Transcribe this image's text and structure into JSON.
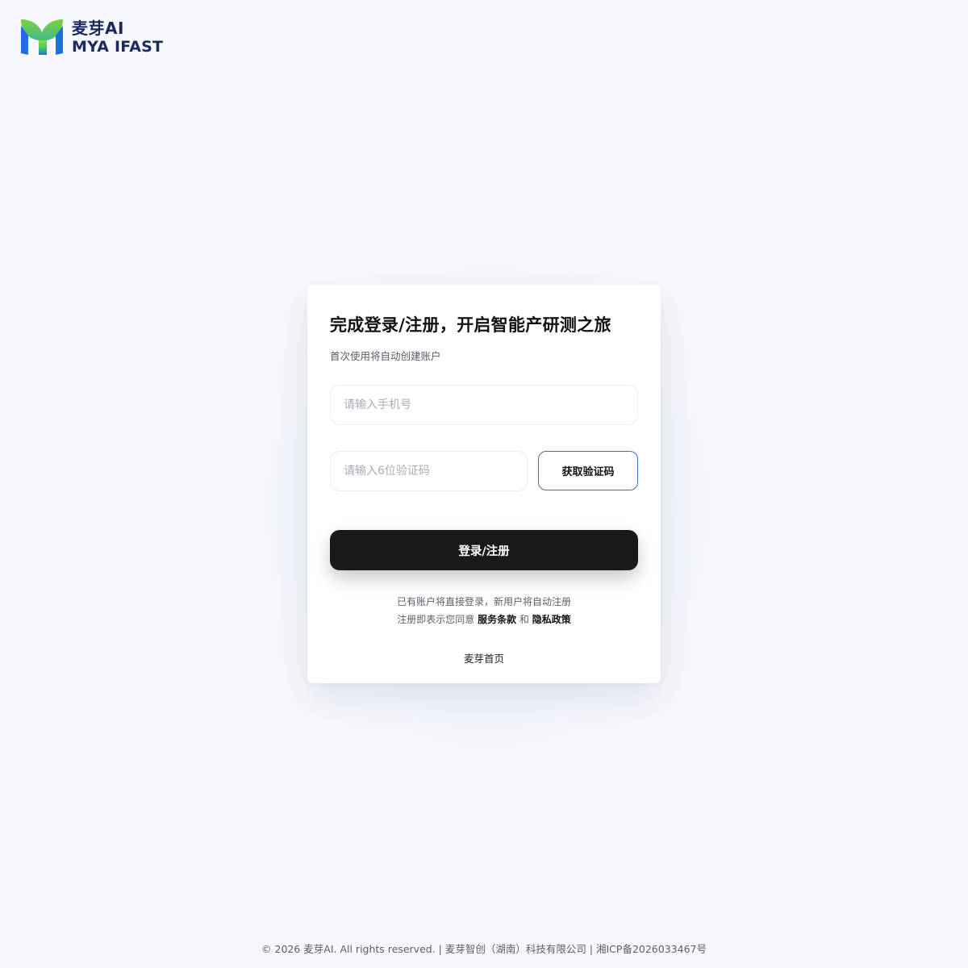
{
  "brand": {
    "name_cn": "麦芽AI",
    "name_en": "MYA IFAST",
    "logo_icon": "sprout-logo-icon",
    "colors": {
      "leaf_green": "#7bd23a",
      "leaf_blue": "#1f6fe0",
      "text": "#1a2a5e"
    }
  },
  "card": {
    "title": "完成登录/注册，开启智能产研测之旅",
    "subtitle": "首次使用将自动创建账户",
    "phone_placeholder": "请输入手机号",
    "phone_value": "",
    "code_placeholder": "请输入6位验证码",
    "code_value": "",
    "get_code_label": "获取验证码",
    "submit_label": "登录/注册",
    "note_line1": "已有账户将直接登录，新用户将自动注册",
    "note_line2_prefix": "注册即表示您同意",
    "terms_label": "服务条款",
    "and_label": "和",
    "privacy_label": "隐私政策",
    "home_link": "麦芽首页"
  },
  "footer": {
    "text": "© 2026 麦芽AI. All rights reserved. | 麦芽智创（湖南）科技有限公司 | 湘ICP备2026033467号"
  },
  "colors": {
    "background": "#f6f8fc",
    "button_dark": "#1a1a1a",
    "code_button_border": "#3d6fc2"
  }
}
